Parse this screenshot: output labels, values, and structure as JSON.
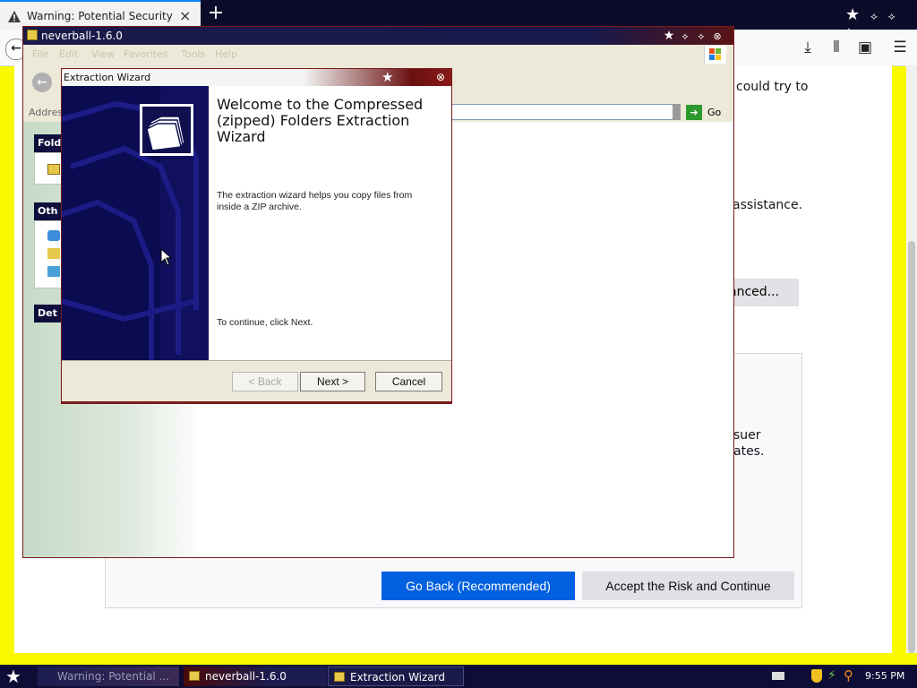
{
  "firefox": {
    "tab_title": "Warning: Potential Security Risk Ahead",
    "tab_close": "×",
    "new_tab": "+",
    "window_controls": [
      "★",
      "⟡",
      "⟡",
      "⟡"
    ],
    "content": {
      "line1": "could try to",
      "line2": "assistance.",
      "advanced_label": "anced...",
      "panel_line1": "suer",
      "panel_line2": "ates.",
      "go_back_label": "Go Back (Recommended)",
      "accept_label": "Accept the Risk and Continue"
    }
  },
  "explorer": {
    "title": "neverball-1.6.0",
    "menu": [
      "File",
      "Edit",
      "View",
      "Favorites",
      "Tools",
      "Help"
    ],
    "address_label": "Address",
    "go_label": "Go",
    "tasks": {
      "box1_head": "Fold",
      "box2_head": "Oth",
      "box3_head": "Det"
    }
  },
  "wizard": {
    "title": "Extraction Wizard",
    "heading": "Welcome to the Compressed (zipped) Folders Extraction Wizard",
    "description": "The extraction wizard helps you copy files from inside a ZIP archive.",
    "continue_text": "To continue, click Next.",
    "back_label": "< Back",
    "next_label": "Next >",
    "cancel_label": "Cancel"
  },
  "taskbar": {
    "tasks": [
      {
        "label": "Warning: Potential ..."
      },
      {
        "label": "neverball-1.6.0"
      },
      {
        "label": "Extraction Wizard"
      }
    ],
    "clock": "9:55 PM"
  },
  "colors": {
    "desktop": "#f9f900",
    "firefox_primary": "#0060df",
    "taskbar": "#0d0d36",
    "wizard_side": "#0a0a50"
  }
}
